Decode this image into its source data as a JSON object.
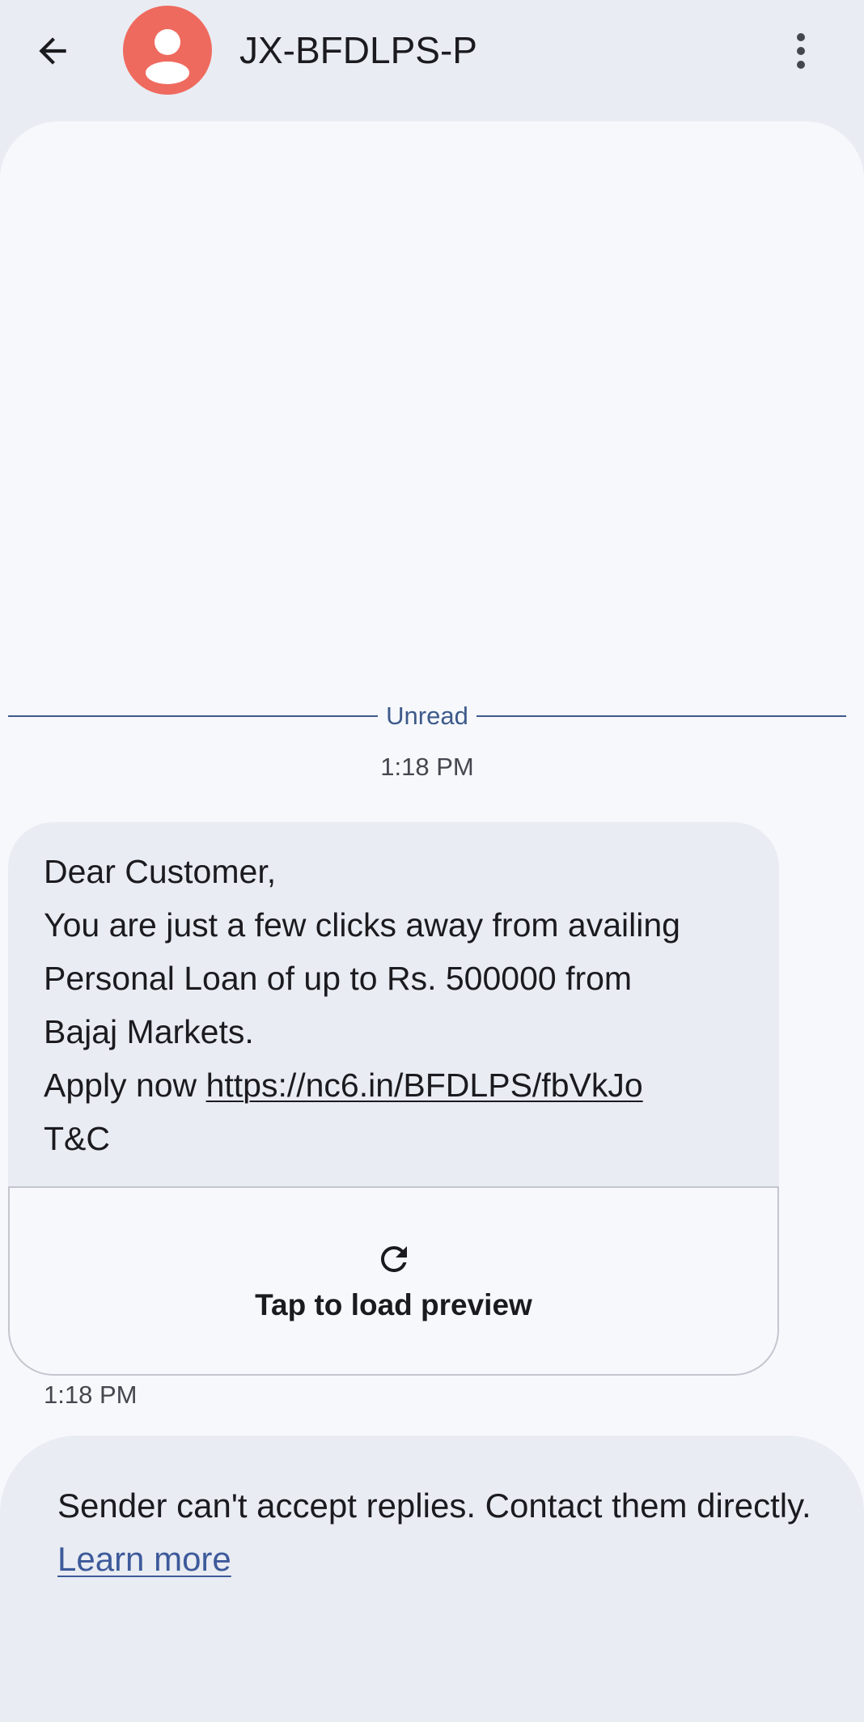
{
  "header": {
    "title": "JX-BFDLPS-P",
    "back_icon": "arrow-back-icon",
    "menu_icon": "more-vert-icon",
    "avatar_color": "#ef6a5e"
  },
  "divider": {
    "label": "Unread"
  },
  "timestamps": {
    "top": "1:18 PM",
    "message": "1:18 PM"
  },
  "message": {
    "lines": [
      "Dear Customer,",
      "You are just a few clicks away from availing",
      "Personal Loan of up to Rs. 500000 from",
      "Bajaj Markets."
    ],
    "apply_prefix": "Apply now ",
    "link": "https://nc6.in/BFDLPS/fbVkJo",
    "tc": "T&C"
  },
  "preview": {
    "label": "Tap to load preview",
    "icon": "refresh-icon"
  },
  "footer": {
    "text": "Sender can't accept replies. Contact them directly. ",
    "link_label": "Learn more"
  },
  "colors": {
    "background": "#e9ecf3",
    "surface": "#f6f8fc",
    "accent": "#3d5a8a"
  }
}
